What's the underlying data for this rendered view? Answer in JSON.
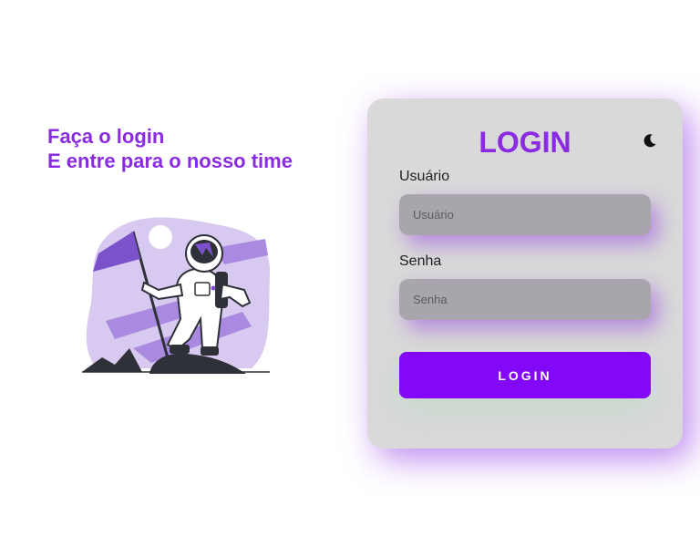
{
  "intro": {
    "line1": "Faça o login",
    "line2": "E entre para o nosso time",
    "illustration_icon": "astronaut-flag-illustration"
  },
  "login_card": {
    "title": "LOGIN",
    "theme_toggle_icon": "moon-icon",
    "username": {
      "label": "Usuário",
      "placeholder": "Usuário",
      "value": ""
    },
    "password": {
      "label": "Senha",
      "placeholder": "Senha",
      "value": ""
    },
    "submit_label": "LOGIN"
  },
  "colors": {
    "accent": "#8a2be2",
    "button": "#8308f7",
    "card_bg": "#d9d9d9",
    "input_bg": "#a9a5ad"
  }
}
